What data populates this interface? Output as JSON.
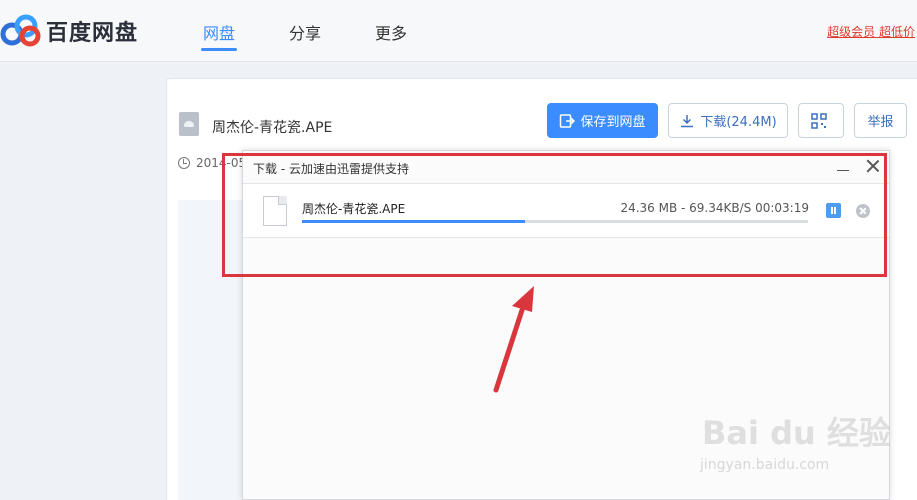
{
  "header": {
    "brand": "百度网盘",
    "nav": [
      {
        "label": "网盘",
        "active": true
      },
      {
        "label": "分享",
        "active": false
      },
      {
        "label": "更多",
        "active": false
      }
    ],
    "vip_link": "超级会员 超低价"
  },
  "file": {
    "name": "周杰伦-青花瓷.APE",
    "date_partial": "2014-05"
  },
  "actions": {
    "save_label": "保存到网盘",
    "download_label": "下载(24.4M)",
    "report_label": "举报"
  },
  "dialog": {
    "title": "下载 - 云加速由迅雷提供支持",
    "item": {
      "name": "周杰伦-青花瓷.APE",
      "stats": "24.36 MB - 69.34KB/S 00:03:19",
      "progress": 0.44
    }
  },
  "watermark": {
    "main": "Bai du 经验",
    "sub": "jingyan.baidu.com"
  },
  "colors": {
    "accent": "#3b8cff",
    "highlight": "#d9363e",
    "vip": "#e0392b"
  }
}
